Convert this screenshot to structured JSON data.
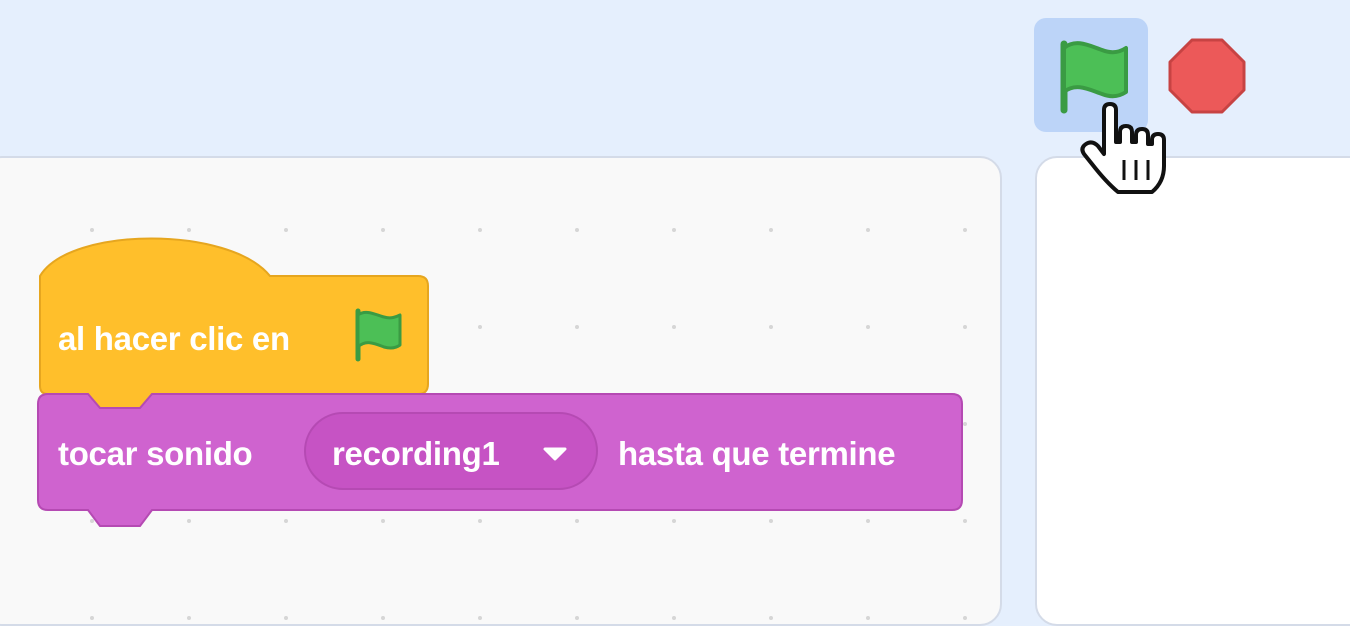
{
  "toolbar": {
    "green_flag_icon": "green-flag-icon",
    "stop_icon": "stop-sign-icon"
  },
  "colors": {
    "events_block": "#ffbf2b",
    "sound_block": "#cf63cf",
    "sound_dropdown": "#c653c4",
    "flag_green": "#4cbf56",
    "stop_red": "#ec5959",
    "header_bg": "#e5effd"
  },
  "script": {
    "hat_block": {
      "label": "al hacer clic en",
      "icon": "green-flag-icon"
    },
    "sound_block": {
      "label_before": "tocar sonido",
      "dropdown_value": "recording1",
      "label_after": "hasta que termine"
    }
  }
}
